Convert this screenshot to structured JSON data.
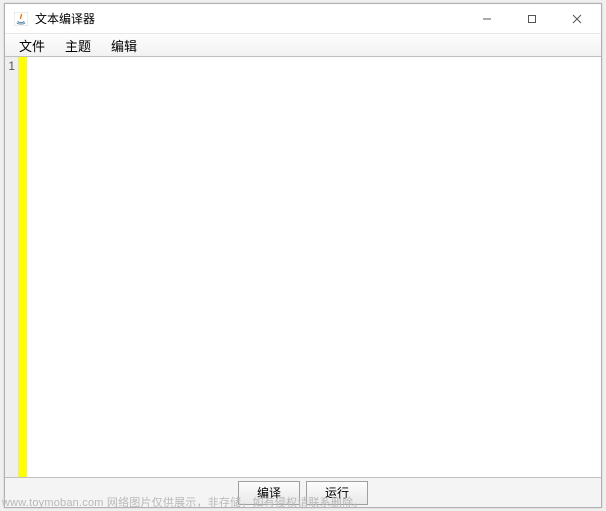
{
  "window": {
    "title": "文本编译器"
  },
  "menubar": {
    "items": [
      {
        "label": "文件"
      },
      {
        "label": "主题"
      },
      {
        "label": "编辑"
      }
    ]
  },
  "editor": {
    "line_numbers": [
      "1"
    ],
    "content": ""
  },
  "buttons": {
    "compile": "编译",
    "run": "运行"
  },
  "watermark": "www.toymoban.com 网络图片仅供展示，非存储，如有侵权请联系删除。",
  "icons": {
    "app": "java-icon",
    "minimize": "minimize-icon",
    "maximize": "maximize-icon",
    "close": "close-icon"
  }
}
